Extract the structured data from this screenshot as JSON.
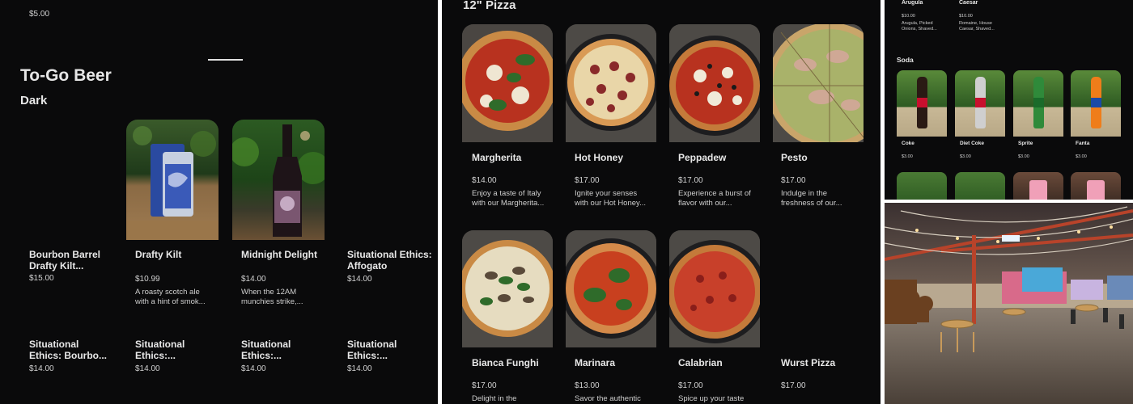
{
  "beer": {
    "top_price": "$5.00",
    "section_title": "To-Go Beer",
    "subsection": "Dark",
    "row1": [
      {
        "name": "Bourbon Barrel Drafty Kilt...",
        "price": "$15.00",
        "desc": ""
      },
      {
        "name": "Drafty Kilt",
        "price": "$10.99",
        "desc": "A roasty scotch ale with a hint of smok..."
      },
      {
        "name": "Midnight Delight",
        "price": "$14.00",
        "desc": "When the 12AM munchies strike,..."
      },
      {
        "name": "Situational Ethics: Affogato",
        "price": "$14.00",
        "desc": ""
      }
    ],
    "row2": [
      {
        "name": "Situational Ethics: Bourbo...",
        "price": "$14.00"
      },
      {
        "name": "Situational Ethics:...",
        "price": "$14.00"
      },
      {
        "name": "Situational Ethics:...",
        "price": "$14.00"
      },
      {
        "name": "Situational Ethics:...",
        "price": "$14.00"
      }
    ]
  },
  "pizza": {
    "section_title": "12\" Pizza",
    "row1": [
      {
        "name": "Margherita",
        "price": "$14.00",
        "desc": "Enjoy a taste of Italy with our Margherita..."
      },
      {
        "name": "Hot Honey",
        "price": "$17.00",
        "desc": "Ignite your senses with our Hot Honey..."
      },
      {
        "name": "Peppadew",
        "price": "$17.00",
        "desc": "Experience a burst of flavor with our..."
      },
      {
        "name": "Pesto",
        "price": "$17.00",
        "desc": "Indulge in the freshness of our..."
      }
    ],
    "row2": [
      {
        "name": "Bianca Funghi",
        "price": "$17.00",
        "desc": "Delight in the"
      },
      {
        "name": "Marinara",
        "price": "$13.00",
        "desc": "Savor the authentic"
      },
      {
        "name": "Calabrian",
        "price": "$17.00",
        "desc": "Spice up your taste"
      },
      {
        "name": "Wurst Pizza",
        "price": "$17.00",
        "desc": ""
      }
    ]
  },
  "salads": [
    {
      "name": "Arugula",
      "price": "$10.00",
      "desc": "Arugula, Picked Onions, Shaved..."
    },
    {
      "name": "Caesar",
      "price": "$10.00",
      "desc": "Romaine, House Caesar, Shaved..."
    }
  ],
  "soda": {
    "section_title": "Soda",
    "items": [
      {
        "name": "Coke",
        "price": "$3.00",
        "bottle_color": "#2a1a14",
        "label_color": "#c8102e"
      },
      {
        "name": "Diet Coke",
        "price": "$3.00",
        "bottle_color": "#cfcfcf",
        "label_color": "#c8102e"
      },
      {
        "name": "Sprite",
        "price": "$3.00",
        "bottle_color": "#2f8a3a",
        "label_color": "#1a6b2a"
      },
      {
        "name": "Fanta",
        "price": "$3.00",
        "bottle_color": "#ef7d1a",
        "label_color": "#1b4aa8"
      }
    ]
  },
  "colors": {
    "background": "#0a0a0b",
    "text": "#e8e8e8",
    "pizza_crust": "#c98a45",
    "tomato": "#b8321f",
    "basil": "#2f6b2a"
  }
}
